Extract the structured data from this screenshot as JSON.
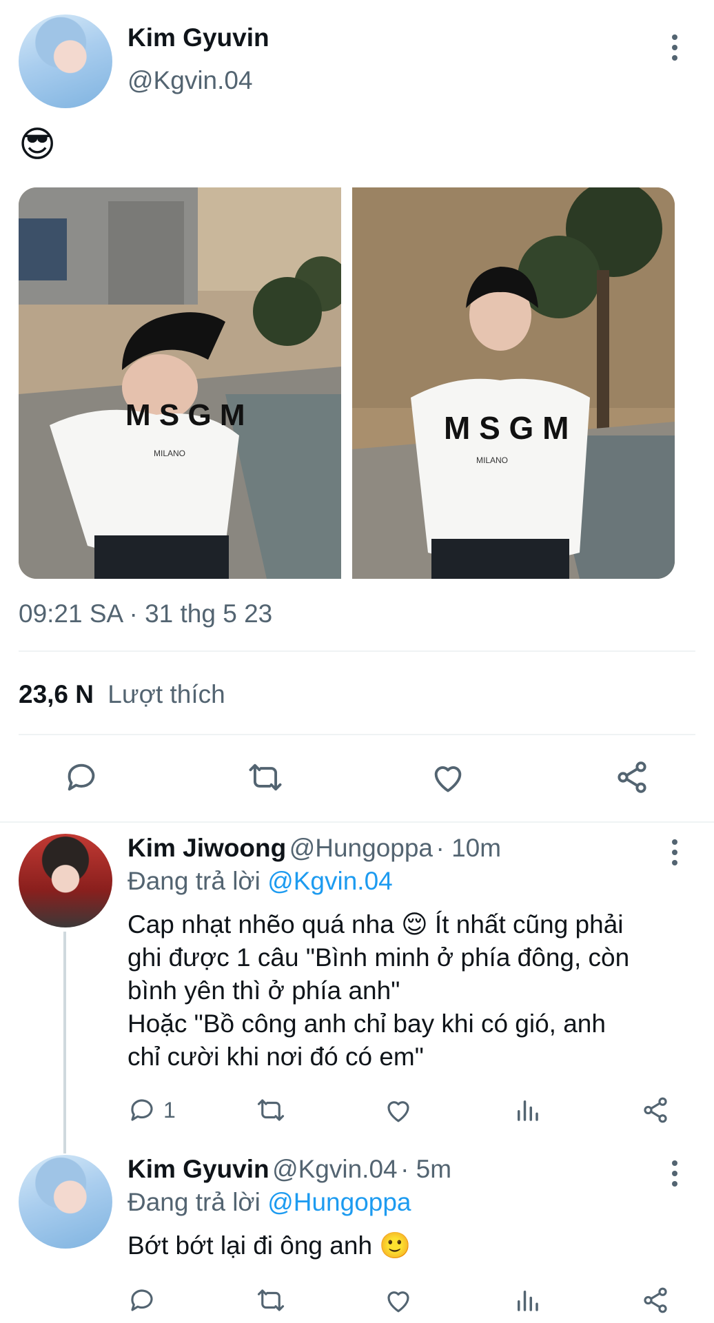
{
  "tweet": {
    "author_name": "Kim Gyuvin",
    "author_handle": "@Kgvin.04",
    "emoji": "😎",
    "timestamp": "09:21 SA · 31 thg 5 23",
    "likes_count": "23,6 N",
    "likes_label": "Lượt thích",
    "images": [
      "photo-1",
      "photo-2"
    ],
    "shirt_text": "MSGM",
    "shirt_subtext": "MILANO",
    "actions": [
      "reply-icon",
      "retweet-icon",
      "like-icon",
      "share-icon"
    ]
  },
  "replies": [
    {
      "author_name": "Kim Jiwoong",
      "author_handle": "@Hungoppa",
      "time": "· 10m",
      "replying_to_label": "Đang trả lời",
      "replying_to": "@Kgvin.04",
      "text_line1": "Cap nhạt nhẽo quá nha 😌 Ít nhất cũng phải",
      "text_line2": "ghi được 1 câu \"Bình minh ở phía đông, còn",
      "text_line3": "bình yên thì ở phía anh\"",
      "text_line4": "Hoặc \"Bồ công anh chỉ bay khi có gió, anh",
      "text_line5": "chỉ cười khi nơi đó có em\"",
      "reply_count": "1"
    },
    {
      "author_name": "Kim Gyuvin",
      "author_handle": "@Kgvin.04",
      "time": "· 5m",
      "replying_to_label": "Đang trả lời",
      "replying_to": "@Hungoppa",
      "text_line1": "Bớt bớt lại đi ông anh 🙂"
    }
  ],
  "colors": {
    "link": "#1d9bf0",
    "muted": "#536471",
    "text": "#0f1419",
    "divider": "#eff3f4"
  }
}
